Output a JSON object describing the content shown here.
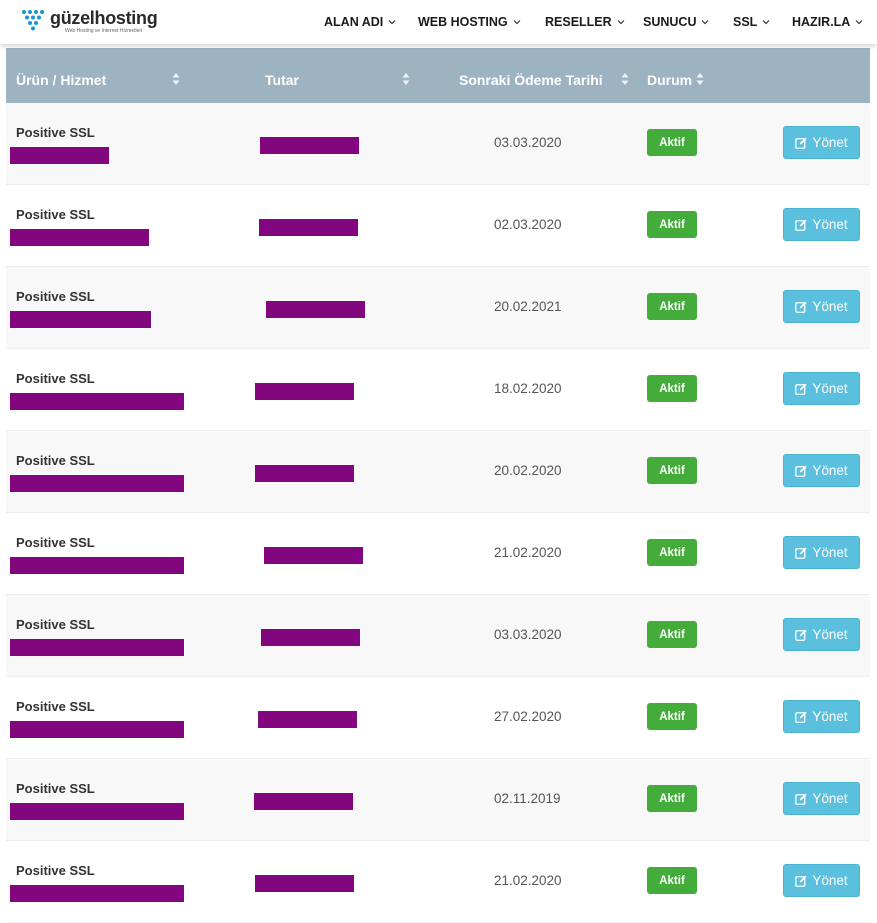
{
  "brand": {
    "name": "güzelhosting",
    "tagline": "Web Hosting ve Internet Hizmetleri",
    "dot_color": "#1a95d6"
  },
  "nav": {
    "items": [
      {
        "label": "ALAN ADI",
        "icon": "chevron-down-icon"
      },
      {
        "label": "WEB HOSTING",
        "icon": "chevron-down-icon"
      },
      {
        "label": "RESELLER",
        "icon": "chevron-down-icon"
      },
      {
        "label": "SUNUCU",
        "icon": "chevron-down-icon"
      },
      {
        "label": "SSL",
        "icon": "chevron-down-icon"
      },
      {
        "label": "HAZIR.LA",
        "icon": "chevron-down-icon"
      }
    ]
  },
  "table": {
    "header_color": "#9db3c2",
    "columns": [
      {
        "label": "Ürün / Hizmet",
        "sortable": true
      },
      {
        "label": "Tutar",
        "sortable": true
      },
      {
        "label": "Sonraki Ödeme Tarihi",
        "sortable": true
      },
      {
        "label": "Durum",
        "sortable": true
      }
    ],
    "rows": [
      {
        "product": "Positive SSL",
        "due": "03.03.2020",
        "status": "Aktif",
        "action": "Yönet"
      },
      {
        "product": "Positive SSL",
        "due": "02.03.2020",
        "status": "Aktif",
        "action": "Yönet"
      },
      {
        "product": "Positive SSL",
        "due": "20.02.2021",
        "status": "Aktif",
        "action": "Yönet"
      },
      {
        "product": "Positive SSL",
        "due": "18.02.2020",
        "status": "Aktif",
        "action": "Yönet"
      },
      {
        "product": "Positive SSL",
        "due": "20.02.2020",
        "status": "Aktif",
        "action": "Yönet"
      },
      {
        "product": "Positive SSL",
        "due": "21.02.2020",
        "status": "Aktif",
        "action": "Yönet"
      },
      {
        "product": "Positive SSL",
        "due": "03.03.2020",
        "status": "Aktif",
        "action": "Yönet"
      },
      {
        "product": "Positive SSL",
        "due": "27.02.2020",
        "status": "Aktif",
        "action": "Yönet"
      },
      {
        "product": "Positive SSL",
        "due": "02.11.2019",
        "status": "Aktif",
        "action": "Yönet"
      },
      {
        "product": "Positive SSL",
        "due": "21.02.2020",
        "status": "Aktif",
        "action": "Yönet"
      }
    ],
    "status_color": "#43ac3b",
    "action_color": "#5bc0de",
    "redaction_color": "#82077f"
  }
}
